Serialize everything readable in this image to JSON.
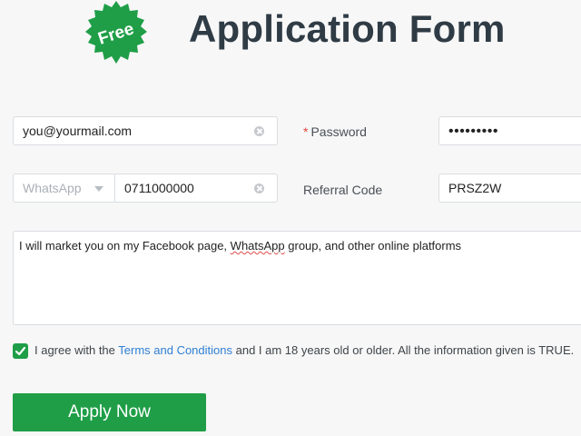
{
  "header": {
    "badge_text": "Free",
    "title": "Application Form"
  },
  "form": {
    "email": {
      "value": "you@yourmail.com"
    },
    "password": {
      "label": "Password",
      "required_mark": "*",
      "value": "•••••••••"
    },
    "phone": {
      "channel": "WhatsApp",
      "number": "0711000000"
    },
    "referral": {
      "label": "Referral Code",
      "value": "PRSZ2W"
    },
    "message": {
      "before": "I will market you on my Facebook page, ",
      "misspelled": "WhatsApp",
      "after": " group, and other online platforms"
    },
    "agreement": {
      "text_1": "I agree with the ",
      "link": "Terms and Conditions",
      "text_2": " and I am 18 years old or older. All the information given is TRUE.",
      "checked": true
    },
    "submit_label": "Apply Now"
  },
  "colors": {
    "accent": "#1f9e47",
    "link": "#2e7fd4",
    "required": "#e0473b"
  }
}
